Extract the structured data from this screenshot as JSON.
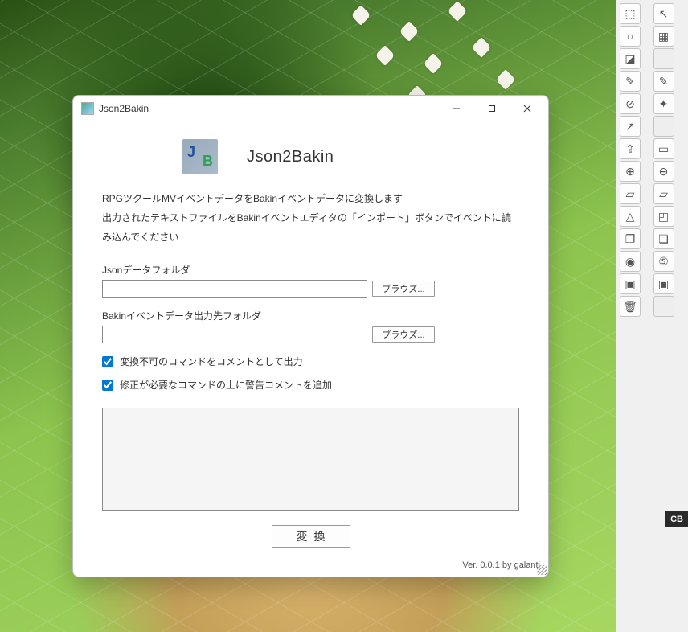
{
  "window": {
    "title": "Json2Bakin",
    "app_title": "Json2Bakin",
    "desc_line1": "RPGツクールMVイベントデータをBakinイベントデータに変換します",
    "desc_line2": "出力されたテキストファイルをBakinイベントエディタの「インポート」ボタンでイベントに読み込んでください",
    "json_folder_label": "Jsonデータフォルダ",
    "json_folder_value": "",
    "json_browse": "ブラウズ...",
    "output_folder_label": "Bakinイベントデータ出力先フォルダ",
    "output_folder_value": "",
    "output_browse": "ブラウズ...",
    "checkbox1_label": "変換不可のコマンドをコメントとして出力",
    "checkbox2_label": "修正が必要なコマンドの上に警告コメントを追加",
    "log_content": "",
    "convert_label": "変換",
    "version": "Ver. 0.0.1 by galanti"
  },
  "toolbar": {
    "items": [
      {
        "icon": "⬚",
        "name": "select-rect-icon"
      },
      {
        "icon": "↖",
        "name": "pointer-icon"
      },
      {
        "icon": "○",
        "name": "lasso-icon"
      },
      {
        "icon": "▦",
        "name": "grid-icon"
      },
      {
        "icon": "◪",
        "name": "terrain-icon"
      },
      {
        "icon": "",
        "name": "blank-1"
      },
      {
        "icon": "✎",
        "name": "pencil-icon"
      },
      {
        "icon": "✎",
        "name": "pencil2-icon"
      },
      {
        "icon": "⊘",
        "name": "eraser-icon"
      },
      {
        "icon": "✦",
        "name": "magic-icon"
      },
      {
        "icon": "↗",
        "name": "path-icon"
      },
      {
        "icon": "",
        "name": "blank-2"
      },
      {
        "icon": "⇪",
        "name": "raise-icon"
      },
      {
        "icon": "▭",
        "name": "flatten-icon"
      },
      {
        "icon": "⊕",
        "name": "center-icon"
      },
      {
        "icon": "⊖",
        "name": "align-icon"
      },
      {
        "icon": "▱",
        "name": "shape1-icon"
      },
      {
        "icon": "▱",
        "name": "shape2-icon"
      },
      {
        "icon": "△",
        "name": "slope-icon"
      },
      {
        "icon": "◰",
        "name": "corner-icon"
      },
      {
        "icon": "❐",
        "name": "copy-icon"
      },
      {
        "icon": "❏",
        "name": "paste-icon"
      },
      {
        "icon": "◉",
        "name": "view-icon"
      },
      {
        "icon": "⑤",
        "name": "num-icon"
      },
      {
        "icon": "▣",
        "name": "layer1-icon"
      },
      {
        "icon": "▣",
        "name": "layer2-icon"
      },
      {
        "icon": "🗑",
        "name": "trash-icon"
      },
      {
        "icon": "",
        "name": "blank-3"
      }
    ]
  },
  "side_label": "CB"
}
